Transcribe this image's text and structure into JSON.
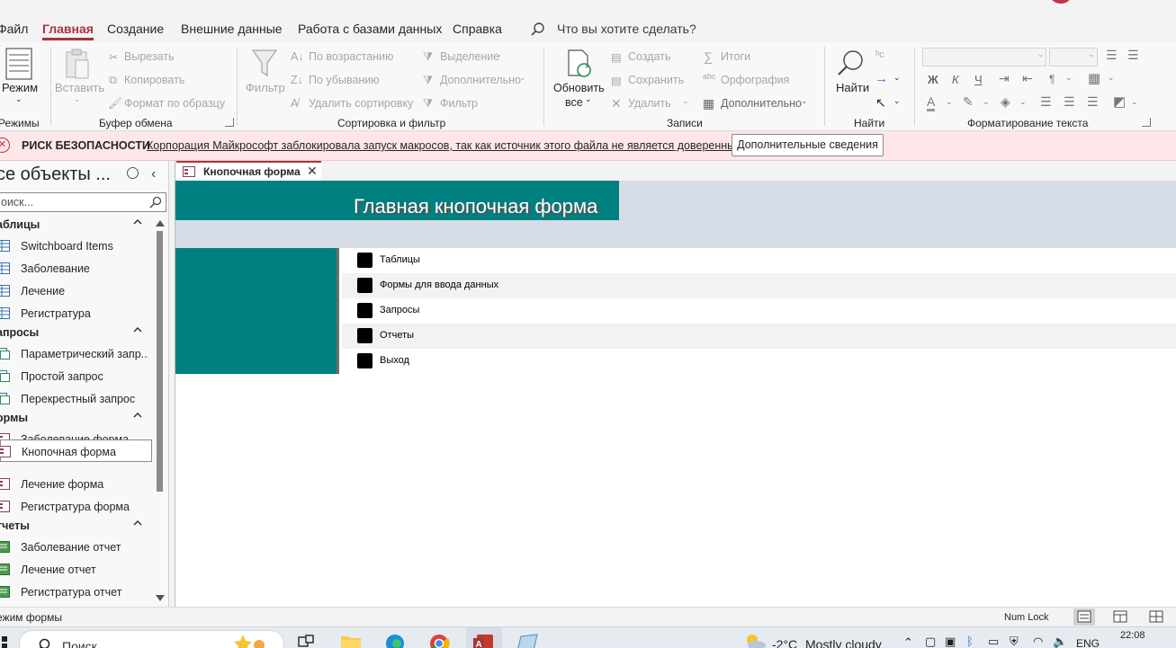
{
  "menu": {
    "tabs": [
      "Файл",
      "Главная",
      "Создание",
      "Внешние данные",
      "Работа с базами данных",
      "Справка"
    ],
    "active_tab": "Главная",
    "tell_me": "Что вы хотите сделать?"
  },
  "ribbon": {
    "views": {
      "mode": "Режим",
      "group": "Режимы"
    },
    "clipboard": {
      "paste": "Вставить",
      "cut": "Вырезать",
      "copy": "Копировать",
      "format_painter": "Формат по образцу",
      "group": "Буфер обмена"
    },
    "sort": {
      "filter": "Фильтр",
      "ascending": "По возрастанию",
      "descending": "По убыванию",
      "remove_sort": "Удалить сортировку",
      "selection": "Выделение",
      "advanced": "Дополнительно",
      "toggle_filter": "Фильтр",
      "group": "Сортировка и фильтр"
    },
    "records": {
      "refresh_line1": "Обновить",
      "refresh_line2": "все",
      "new": "Создать",
      "save": "Сохранить",
      "delete": "Удалить",
      "totals": "Итоги",
      "spelling": "Орфография",
      "more": "Дополнительно",
      "group": "Записи"
    },
    "find": {
      "find": "Найти",
      "group": "Найти"
    },
    "text": {
      "bold": "Ж",
      "italic": "К",
      "underline": "Ч",
      "font_color_letter": "A",
      "group": "Форматирование текста"
    }
  },
  "security": {
    "title": "РИСК БЕЗОПАСНОСТИ",
    "message": "Корпорация Майкрософт заблокировала запуск макросов, так как источник этого файла не является доверенным.",
    "button": "Дополнительные сведения"
  },
  "nav": {
    "title": "се объекты ...",
    "search_placeholder": "оиск...",
    "groups": [
      {
        "title": "аблицы",
        "items": [
          "Switchboard Items",
          "Заболевание",
          "Лечение",
          "Регистратура"
        ]
      },
      {
        "title": "апросы",
        "items": [
          "Параметрический запр...",
          "Простой запрос",
          "Перекрестный запрос"
        ]
      },
      {
        "title": "ормы",
        "items": [
          "Заболевание форма",
          "Кнопочная форма",
          "Лечение форма",
          "Регистратура форма"
        ]
      },
      {
        "title": "тчеты",
        "items": [
          "Заболевание отчет",
          "Лечение отчет",
          "Регистратура отчет"
        ]
      }
    ],
    "selected_item": "Кнопочная форма"
  },
  "document": {
    "tab_label": "Кнопочная форма",
    "form_title": "Главная кнопочная форма",
    "buttons": [
      "Таблицы",
      "Формы для ввода данных",
      "Запросы",
      "Отчеты",
      "Выход"
    ]
  },
  "status": {
    "mode": "ежим формы",
    "numlock": "Num Lock"
  },
  "taskbar": {
    "search": "Поиск",
    "weather": "-2°C",
    "weather_desc": "Mostly cloudy",
    "lang": "ENG",
    "time": "22:08"
  },
  "colors": {
    "accent": "#a4373a",
    "teal": "#008080",
    "security_bg": "#fde7e9",
    "form_header": "#d6dce5"
  }
}
